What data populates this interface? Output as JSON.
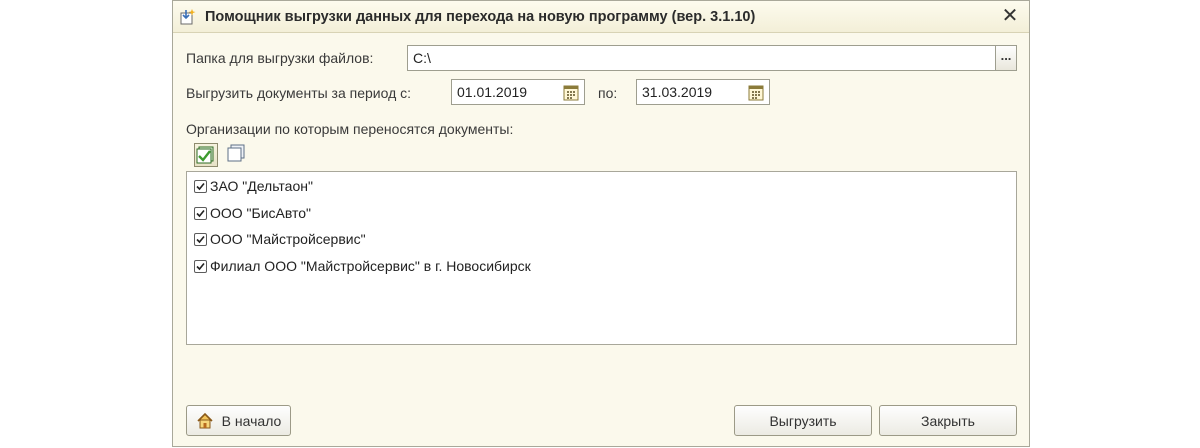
{
  "window": {
    "title": "Помощник выгрузки данных для перехода на новую программу (вер. 3.1.10)",
    "close_glyph": "✕"
  },
  "form": {
    "folder_label": "Папка для выгрузки файлов:",
    "folder_value": "C:\\",
    "folder_browse": "...",
    "period_label": "Выгрузить документы за период с:",
    "date_from": "01.01.2019",
    "to_label": "по:",
    "date_to": "31.03.2019",
    "orgs_label": "Организации по которым переносятся документы:"
  },
  "organizations": [
    {
      "name": "ЗАО \"Дельтаон\"",
      "checked": true
    },
    {
      "name": "ООО \"БисАвто\"",
      "checked": true
    },
    {
      "name": "ООО \"Майстройсервис\"",
      "checked": true
    },
    {
      "name": "Филиал ООО \"Майстройсервис\" в г. Новосибирск",
      "checked": true
    }
  ],
  "buttons": {
    "home": "В начало",
    "export": "Выгрузить",
    "close": "Закрыть"
  },
  "icons": {
    "title": "export-wizard-icon",
    "check_all": "check-all-icon",
    "uncheck_all": "uncheck-all-icon",
    "calendar": "calendar-icon",
    "home": "home-icon"
  },
  "colors": {
    "window_bg": "#fbf9ec",
    "check_green": "#3c9a2e"
  }
}
